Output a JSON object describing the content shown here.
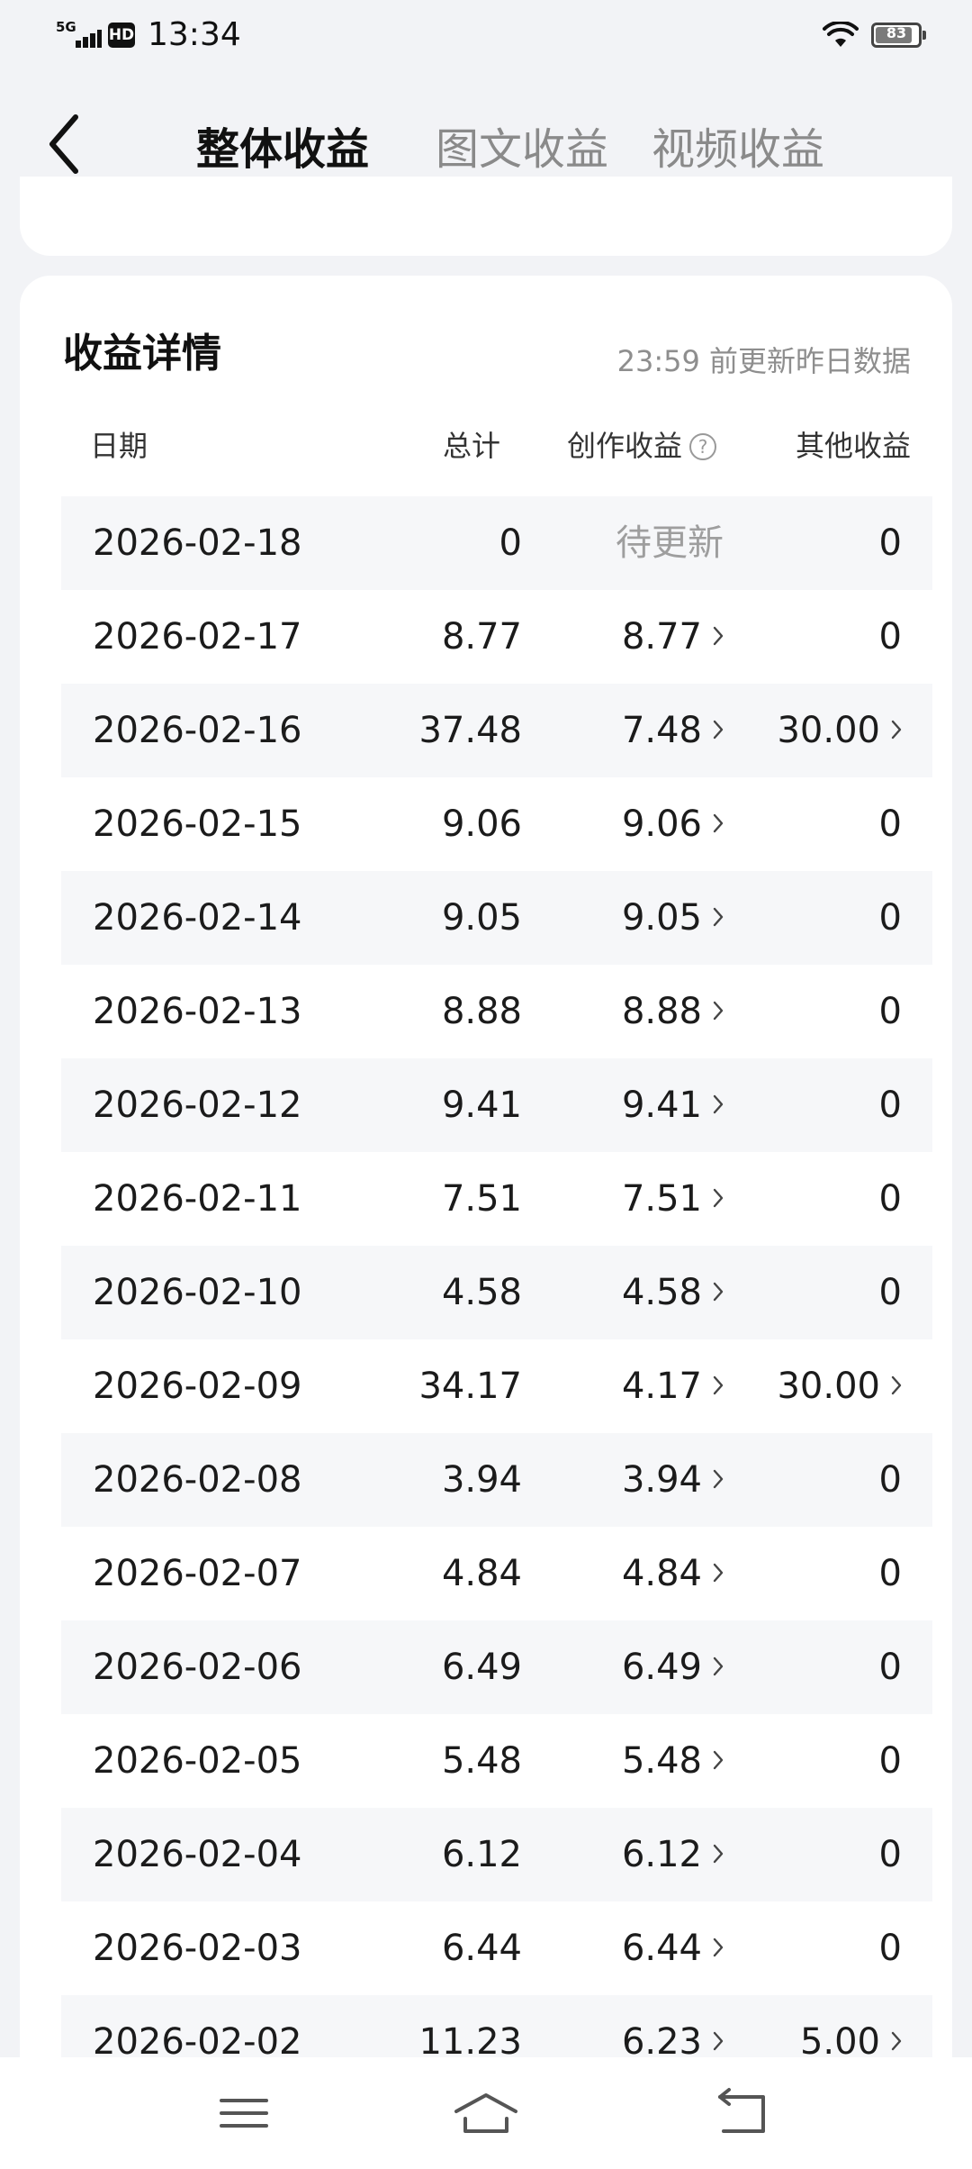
{
  "status_bar": {
    "network": "5G",
    "hd_badge": "HD",
    "time": "13:34",
    "battery": "83"
  },
  "header": {
    "tabs": [
      {
        "label": "整体收益",
        "active": true
      },
      {
        "label": "图文收益",
        "active": false
      },
      {
        "label": "视频收益",
        "active": false
      }
    ]
  },
  "details": {
    "title": "收益详情",
    "update_note": "23:59 前更新昨日数据",
    "columns": {
      "date": "日期",
      "total": "总计",
      "creation": "创作收益",
      "other": "其他收益"
    },
    "rows": [
      {
        "date": "2026-02-18",
        "total": "0",
        "creation": "待更新",
        "other": "0"
      },
      {
        "date": "2026-02-17",
        "total": "8.77",
        "creation": "8.77",
        "other": "0"
      },
      {
        "date": "2026-02-16",
        "total": "37.48",
        "creation": "7.48",
        "other": "30.00"
      },
      {
        "date": "2026-02-15",
        "total": "9.06",
        "creation": "9.06",
        "other": "0"
      },
      {
        "date": "2026-02-14",
        "total": "9.05",
        "creation": "9.05",
        "other": "0"
      },
      {
        "date": "2026-02-13",
        "total": "8.88",
        "creation": "8.88",
        "other": "0"
      },
      {
        "date": "2026-02-12",
        "total": "9.41",
        "creation": "9.41",
        "other": "0"
      },
      {
        "date": "2026-02-11",
        "total": "7.51",
        "creation": "7.51",
        "other": "0"
      },
      {
        "date": "2026-02-10",
        "total": "4.58",
        "creation": "4.58",
        "other": "0"
      },
      {
        "date": "2026-02-09",
        "total": "34.17",
        "creation": "4.17",
        "other": "30.00"
      },
      {
        "date": "2026-02-08",
        "total": "3.94",
        "creation": "3.94",
        "other": "0"
      },
      {
        "date": "2026-02-07",
        "total": "4.84",
        "creation": "4.84",
        "other": "0"
      },
      {
        "date": "2026-02-06",
        "total": "6.49",
        "creation": "6.49",
        "other": "0"
      },
      {
        "date": "2026-02-05",
        "total": "5.48",
        "creation": "5.48",
        "other": "0"
      },
      {
        "date": "2026-02-04",
        "total": "6.12",
        "creation": "6.12",
        "other": "0"
      },
      {
        "date": "2026-02-03",
        "total": "6.44",
        "creation": "6.44",
        "other": "0"
      },
      {
        "date": "2026-02-02",
        "total": "11.23",
        "creation": "6.23",
        "other": "5.00"
      }
    ]
  }
}
